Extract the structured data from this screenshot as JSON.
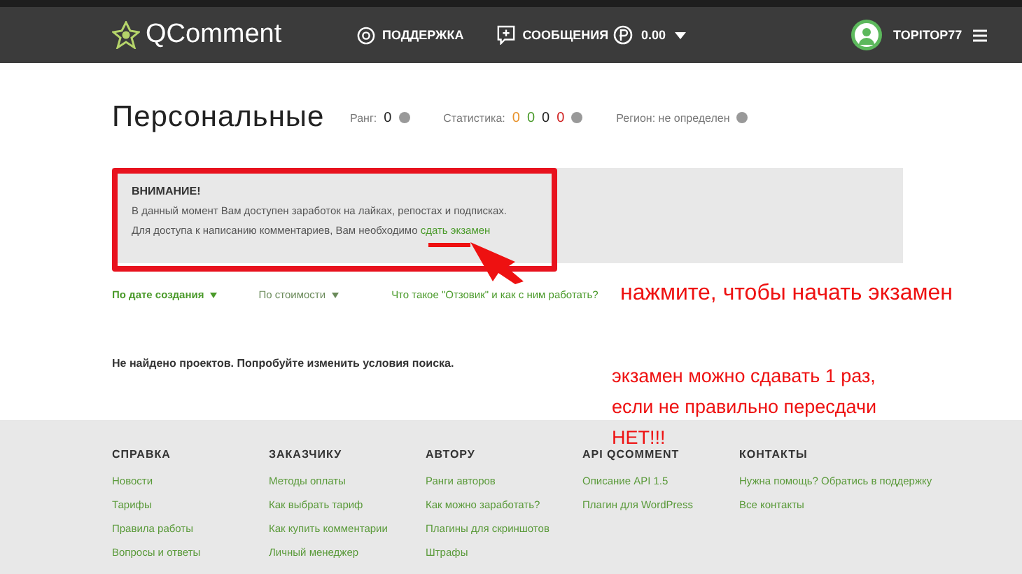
{
  "header": {
    "logo": "QComment",
    "nav": [
      {
        "kind": "support",
        "label": "ПОДДЕРЖКА"
      },
      {
        "kind": "messages",
        "label": "СООБЩЕНИЯ"
      }
    ],
    "balance": "0.00",
    "username": "TOPITOP77"
  },
  "page": {
    "title": "Персональные",
    "rank_label": "Ранг:",
    "rank": "0",
    "stats_label": "Статистика:",
    "stats": [
      {
        "value": "0",
        "color": "#e8922a"
      },
      {
        "value": "0",
        "color": "#4a9a2a"
      },
      {
        "value": "0",
        "color": "#222222"
      },
      {
        "value": "0",
        "color": "#d02020"
      }
    ],
    "region": "Регион: не определен"
  },
  "notice": {
    "title": "ВНИМАНИЕ!",
    "line_1": "В данный момент Вам доступен заработок на лайках, репостах и подписках.",
    "line_2": "Для доступа к написанию комментариев, Вам необходимо",
    "link": "сдать экзамен"
  },
  "sort": [
    {
      "label": "По дате создания",
      "selected": true
    },
    {
      "label": "По стоимости",
      "selected": false
    }
  ],
  "help_link": "Что такое \"Отзовик\" и как с ним работать?",
  "empty_message": "Не найдено проектов. Попробуйте изменить условия поиска.",
  "annotations": {
    "callout": "нажмите, чтобы начать экзамен",
    "warning_lines": [
      "экзамен можно сдавать 1 раз,",
      "если не правильно пересдачи",
      "НЕТ!!!"
    ]
  },
  "footer": [
    {
      "heading": "СПРАВКА",
      "links": [
        "Новости",
        "Тарифы",
        "Правила работы",
        "Вопросы и ответы"
      ]
    },
    {
      "heading": "ЗАКАЗЧИКУ",
      "links": [
        "Методы оплаты",
        "Как выбрать тариф",
        "Как купить комментарии",
        "Личный менеджер"
      ]
    },
    {
      "heading": "АВТОРУ",
      "links": [
        "Ранги авторов",
        "Как можно заработать?",
        "Плагины для скриншотов",
        "Штрафы"
      ]
    },
    {
      "heading": "API QCOMMENT",
      "links": [
        "Описание API 1.5",
        "Плагин для WordPress"
      ]
    },
    {
      "heading": "КОНТАКТЫ",
      "links": [
        "Нужна помощь? Обратись в поддержку",
        "Все контакты"
      ]
    }
  ]
}
